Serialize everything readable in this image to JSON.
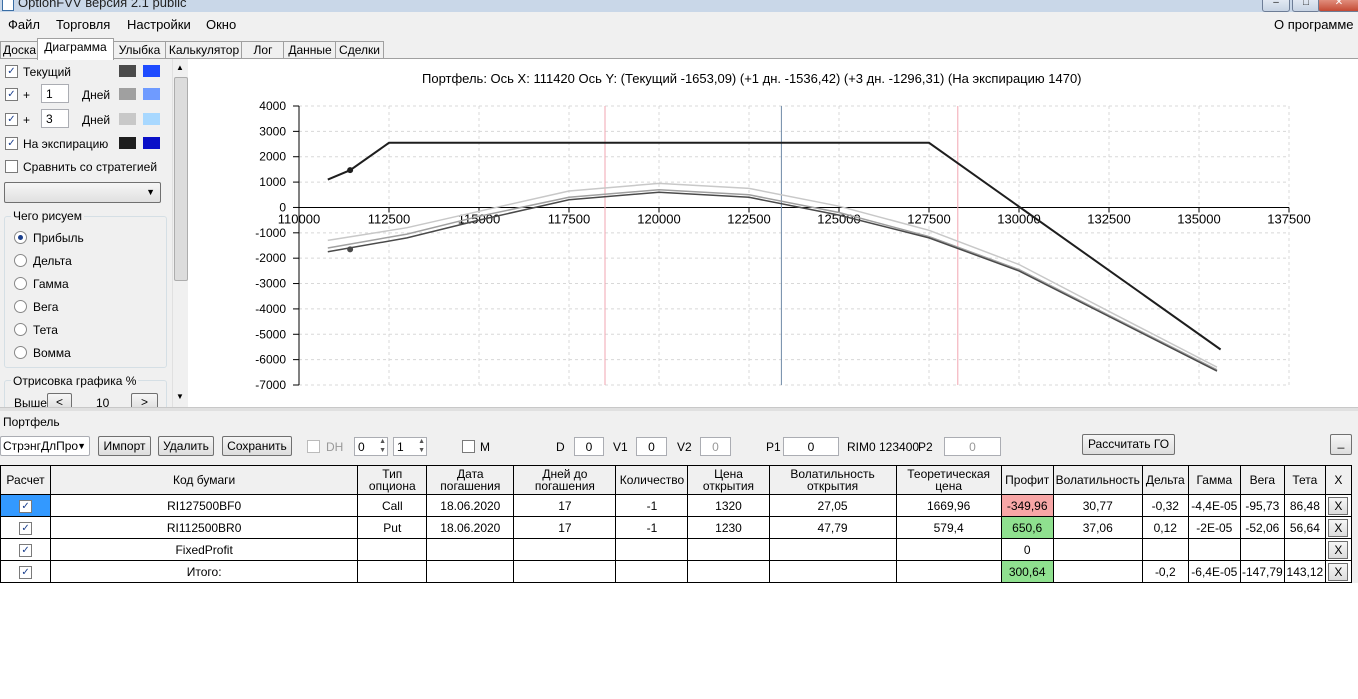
{
  "window": {
    "title": "OptionFVV версия 2.1 public"
  },
  "menu": {
    "items": [
      "Файл",
      "Торговля",
      "Настройки",
      "Окно"
    ],
    "about": "О программе"
  },
  "tabs": [
    "Доска",
    "Диаграмма",
    "Улыбка",
    "Калькулятор",
    "Лог",
    "Данные",
    "Сделки"
  ],
  "active_tab": "Диаграмма",
  "left": {
    "current_label": "Текущий",
    "plus1": {
      "sign": "+",
      "value": "1",
      "unit": "Дней"
    },
    "plus2": {
      "sign": "+",
      "value": "3",
      "unit": "Дней"
    },
    "expiry_label": "На экспирацию",
    "compare_label": "Сравнить со стратегией",
    "draw_group": "Чего рисуем",
    "radio": [
      "Прибыль",
      "Дельта",
      "Гамма",
      "Вега",
      "Тета",
      "Вомма"
    ],
    "selected_radio": "Прибыль",
    "chart_percent_group": "Отрисовка графика %",
    "above_label": "Выше",
    "above_value": "10",
    "prev": "<",
    "next": ">",
    "colors": {
      "current": [
        "#4a4a4a",
        "#1e4bff"
      ],
      "plus1": [
        "#a0a0a0",
        "#6f9bff"
      ],
      "plus2": [
        "#c8c8c8",
        "#a8d8ff"
      ],
      "expiry": [
        "#1e1e1e",
        "#0a10c8"
      ]
    }
  },
  "chart": {
    "header": "Портфель: Ось X:  111420 Ось Y:  (Текущий -1653,09)  (+1 дн. -1536,42)  (+3 дн. -1296,31)  (На экспирацию 1470)"
  },
  "chart_data": {
    "type": "line",
    "xlim": [
      110000,
      137500
    ],
    "ylim": [
      -7000,
      4000
    ],
    "x_ticks": [
      110000,
      112500,
      115000,
      117500,
      120000,
      122500,
      125000,
      127500,
      130000,
      132500,
      135000,
      137500
    ],
    "y_ticks": [
      4000,
      3000,
      2000,
      1000,
      0,
      -1000,
      -2000,
      -3000,
      -4000,
      -5000,
      -6000,
      -7000
    ],
    "vertical_lines": [
      {
        "x": 118500,
        "color": "#f2a6b0"
      },
      {
        "x": 123400,
        "color": "#6f8aa8"
      },
      {
        "x": 128300,
        "color": "#f2a6b0"
      }
    ],
    "series": [
      {
        "x": [
          110800,
          111420,
          112500,
          127500,
          135600
        ],
        "y": [
          1100,
          1470,
          2550,
          2550,
          -5600
        ],
        "color": "#1e1e1e"
      },
      {
        "x": [
          110800,
          113000,
          115000,
          117500,
          120000,
          122500,
          125000,
          127500,
          130000,
          132500,
          135500
        ],
        "y": [
          -1750,
          -1200,
          -500,
          300,
          600,
          400,
          -300,
          -1200,
          -2500,
          -4300,
          -6450
        ],
        "color": "#4a4a4a"
      },
      {
        "x": [
          110800,
          113000,
          115000,
          117500,
          120000,
          122500,
          125000,
          127500,
          130000,
          132500,
          135500
        ],
        "y": [
          -1600,
          -1050,
          -350,
          400,
          700,
          500,
          -200,
          -1150,
          -2450,
          -4250,
          -6400
        ],
        "color": "#a0a0a0"
      },
      {
        "x": [
          110800,
          113000,
          115000,
          117500,
          120000,
          122500,
          125000,
          127500,
          130000,
          132500,
          135500
        ],
        "y": [
          -1300,
          -800,
          -150,
          650,
          950,
          750,
          50,
          -900,
          -2250,
          -4100,
          -6300
        ],
        "color": "#c8c8c8"
      }
    ],
    "markers": [
      {
        "x": 111420,
        "y": 1470,
        "color": "#1e1e1e"
      },
      {
        "x": 111420,
        "y": -1653,
        "color": "#4a4a4a"
      }
    ]
  },
  "portfolio": {
    "label": "Портфель",
    "strategy": "СтрэнгДлПро",
    "import": "Импорт",
    "delete": "Удалить",
    "save": "Сохранить",
    "dh": "DH",
    "spin1": "0",
    "spin2": "1",
    "m": "M",
    "d_label": "D",
    "d_value": "0",
    "v1_label": "V1",
    "v1_value": "0",
    "v2_label": "V2",
    "v2_value": "0",
    "p1_label": "P1",
    "p1_value": "0",
    "rim": "RIM0 123400",
    "p2_label": "P2",
    "p2_value": "0",
    "calc_go": "Рассчитать ГО",
    "min": "_"
  },
  "grid": {
    "headers": [
      "Расчет",
      "Код бумаги",
      "Тип опциона",
      "Дата погашения",
      "Дней до погашения",
      "Количество",
      "Цена открытия",
      "Волатильность открытия",
      "Теоретическая цена",
      "Профит",
      "Волатильность",
      "Дельта",
      "Гамма",
      "Вега",
      "Тета",
      "X"
    ],
    "rows": [
      {
        "code": "RI127500BF0",
        "type": "Call",
        "date": "18.06.2020",
        "days": "17",
        "qty": "-1",
        "price": "1320",
        "vol_open": "27,05",
        "theor": "1669,96",
        "profit": "-349,96",
        "profit_color": "#f7a6a6",
        "vol": "30,77",
        "delta": "-0,32",
        "gamma": "-4,4E-05",
        "vega": "-95,73",
        "theta": "86,48"
      },
      {
        "code": "RI112500BR0",
        "type": "Put",
        "date": "18.06.2020",
        "days": "17",
        "qty": "-1",
        "price": "1230",
        "vol_open": "47,79",
        "theor": "579,4",
        "profit": "650,6",
        "profit_color": "#8fe08f",
        "vol": "37,06",
        "delta": "0,12",
        "gamma": "-2E-05",
        "vega": "-52,06",
        "theta": "56,64"
      },
      {
        "code": "FixedProfit",
        "type": "",
        "date": "",
        "days": "",
        "qty": "",
        "price": "",
        "vol_open": "",
        "theor": "",
        "profit": "0",
        "profit_color": "#ffffff",
        "vol": "",
        "delta": "",
        "gamma": "",
        "vega": "",
        "theta": ""
      },
      {
        "code": "Итого:",
        "type": "",
        "date": "",
        "days": "",
        "qty": "",
        "price": "",
        "vol_open": "",
        "theor": "",
        "profit": "300,64",
        "profit_color": "#8fe08f",
        "vol": "",
        "delta": "-0,2",
        "gamma": "-6,4E-05",
        "vega": "-147,79",
        "theta": "143,12"
      }
    ],
    "x_label": "X"
  }
}
